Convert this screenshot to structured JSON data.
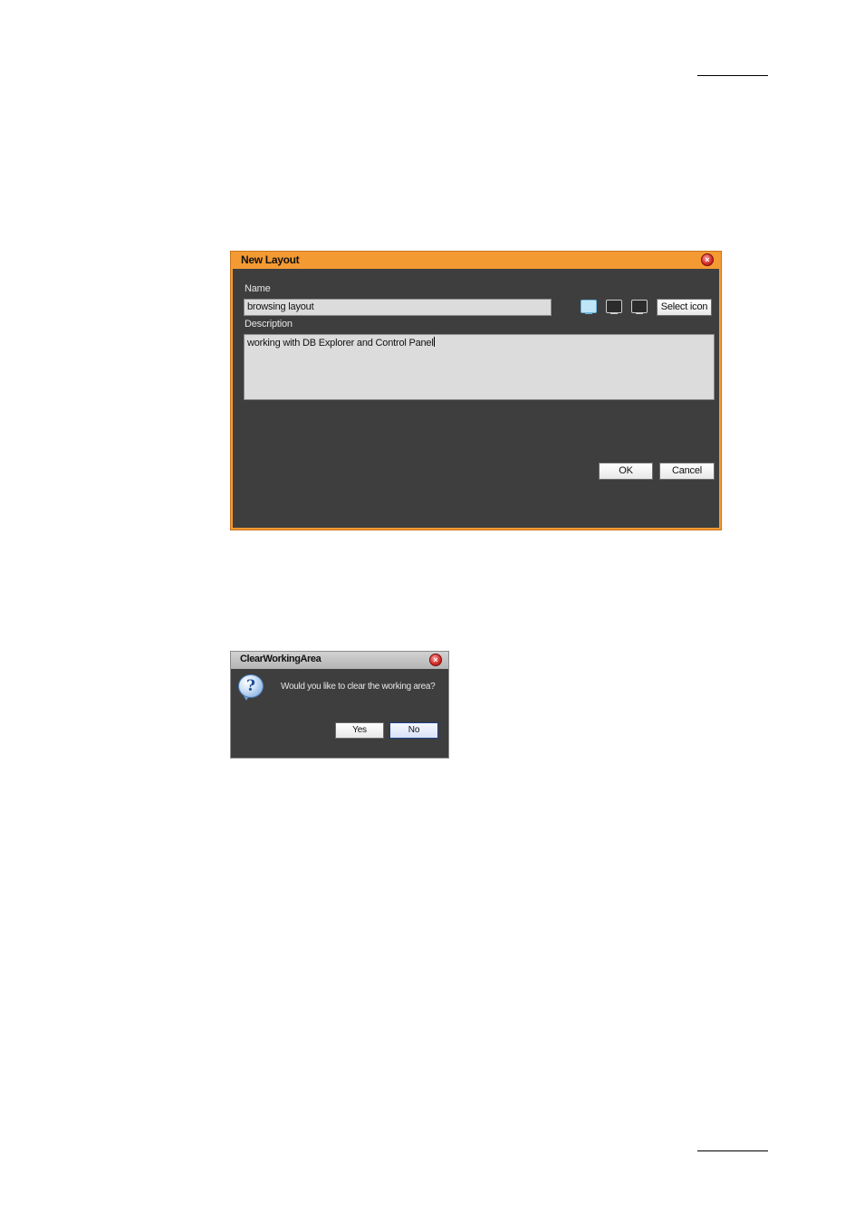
{
  "new_layout_dialog": {
    "title": "New Layout",
    "name_label": "Name",
    "name_value": "browsing layout",
    "description_label": "Description",
    "description_value": "working with DB Explorer and Control Panel",
    "icon_options": [
      "monitor-icon",
      "monitor-icon",
      "monitor-icon"
    ],
    "selected_icon_index": 0,
    "select_icon_label": "Select icon",
    "ok_label": "OK",
    "cancel_label": "Cancel",
    "accent_color": "#f49a33"
  },
  "clear_dialog": {
    "title": "ClearWorkingArea",
    "message": "Would you like to clear the working area?",
    "icon": "question-icon",
    "yes_label": "Yes",
    "no_label": "No"
  }
}
